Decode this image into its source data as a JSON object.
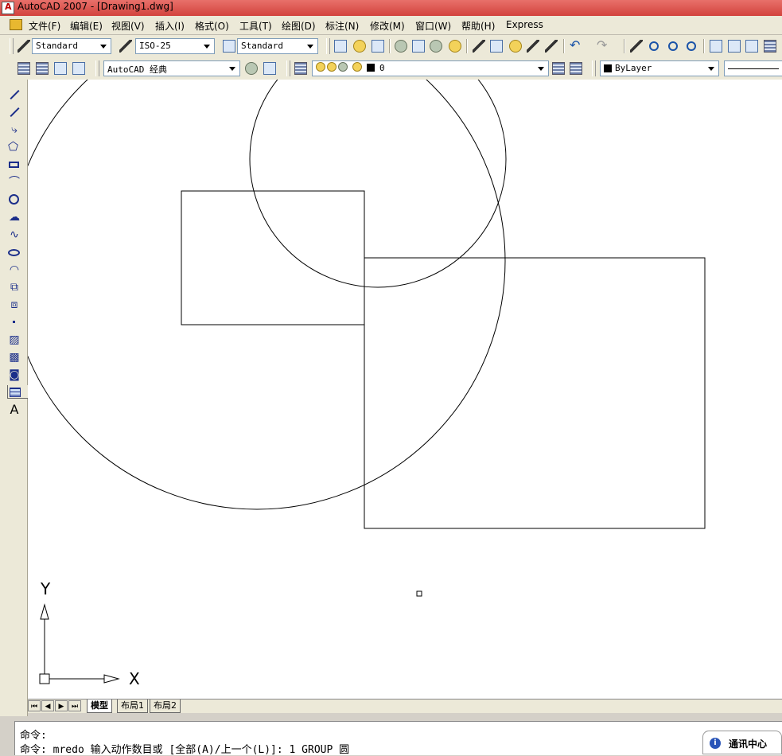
{
  "window": {
    "title": "AutoCAD 2007 - [Drawing1.dwg]"
  },
  "menu": [
    "文件(F)",
    "编辑(E)",
    "视图(V)",
    "插入(I)",
    "格式(O)",
    "工具(T)",
    "绘图(D)",
    "标注(N)",
    "修改(M)",
    "窗口(W)",
    "帮助(H)",
    "Express"
  ],
  "styles_toolbar": {
    "text_style": "Standard",
    "dim_style": "ISO-25",
    "table_style": "Standard"
  },
  "workspace_toolbar": {
    "workspace": "AutoCAD 经典",
    "layer": "0",
    "color": "ByLayer"
  },
  "layout_tabs": [
    "模型",
    "布局1",
    "布局2"
  ],
  "active_tab": "模型",
  "ucs": {
    "x_label": "X",
    "y_label": "Y"
  },
  "command_line": {
    "line1": "命令:",
    "line2": "命令:  mredo 输入动作数目或 [全部(A)/上一个(L)]: 1 GROUP 圆"
  },
  "comm_center": {
    "label": "通讯中心"
  }
}
